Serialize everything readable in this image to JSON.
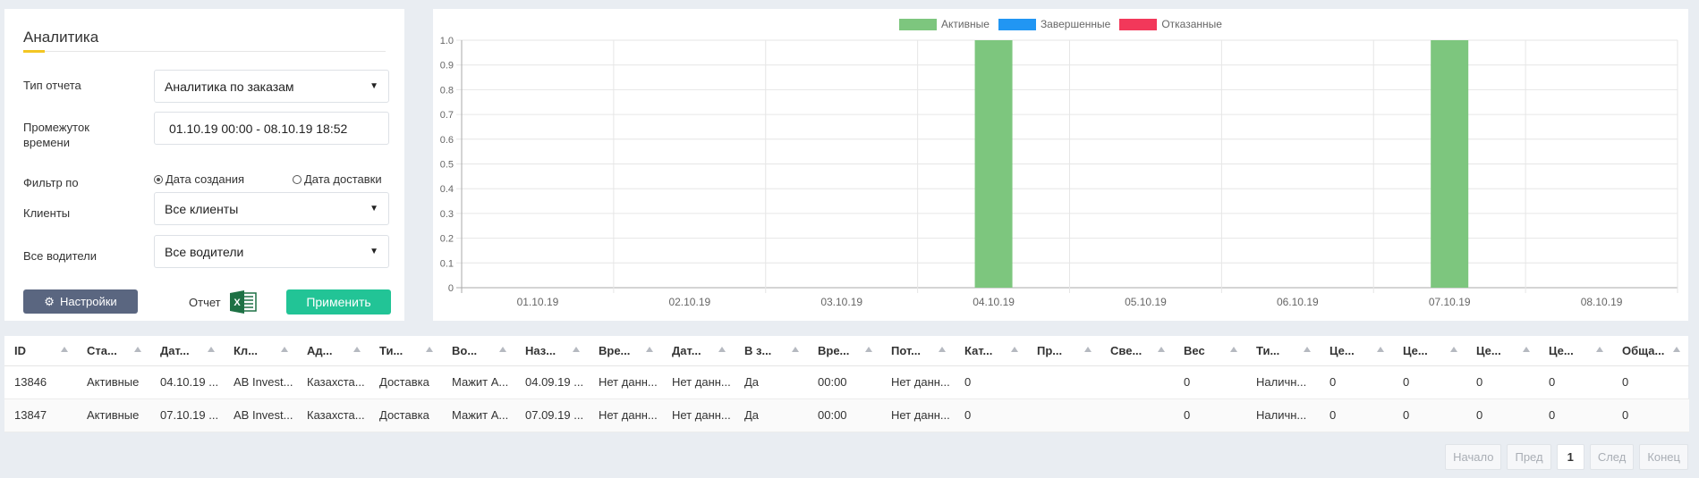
{
  "analytics": {
    "title": "Аналитика",
    "report_type_label": "Тип отчета",
    "report_type_value": "Аналитика по заказам",
    "time_range_label": "Промежуток времени",
    "time_range_value": "01.10.19 00:00 - 08.10.19 18:52",
    "filter_label": "Фильтр по",
    "filter_options": [
      "Дата создания",
      "Дата доставки"
    ],
    "filter_selected": "Дата создания",
    "clients_label": "Клиенты",
    "clients_value": "Все клиенты",
    "drivers_label": "Все водители",
    "drivers_value": "Все водители",
    "settings_button": "Настройки",
    "report_label": "Отчет",
    "apply_button": "Применить"
  },
  "colors": {
    "active": "#7dc67e",
    "completed": "#2196f3",
    "rejected": "#f2385a",
    "apply": "#22c496",
    "settings": "#5a6680"
  },
  "chart_data": {
    "type": "bar",
    "categories": [
      "01.10.19",
      "02.10.19",
      "03.10.19",
      "04.10.19",
      "05.10.19",
      "06.10.19",
      "07.10.19",
      "08.10.19"
    ],
    "series": [
      {
        "name": "Активные",
        "values": [
          0,
          0,
          0,
          1,
          0,
          0,
          1,
          0
        ],
        "color": "#7dc67e"
      },
      {
        "name": "Завершенные",
        "values": [
          0,
          0,
          0,
          0,
          0,
          0,
          0,
          0
        ],
        "color": "#2196f3"
      },
      {
        "name": "Отказанные",
        "values": [
          0,
          0,
          0,
          0,
          0,
          0,
          0,
          0
        ],
        "color": "#f2385a"
      }
    ],
    "y_ticks": [
      "0",
      "0.1",
      "0.2",
      "0.3",
      "0.4",
      "0.5",
      "0.6",
      "0.7",
      "0.8",
      "0.9",
      "1.0"
    ],
    "ylim": [
      0,
      1
    ],
    "grid": true,
    "legend": "top-center"
  },
  "table": {
    "columns": [
      "ID",
      "Ста...",
      "Дат...",
      "Кл...",
      "Ад...",
      "Ти...",
      "Во...",
      "Наз...",
      "Вре...",
      "Дат...",
      "В з...",
      "Вре...",
      "Пот...",
      "Кат...",
      "Пр...",
      "Све...",
      "Вес",
      "Ти...",
      "Це...",
      "Це...",
      "Це...",
      "Це...",
      "Обща..."
    ],
    "rows": [
      [
        "13846",
        "Активные",
        "04.10.19 ...",
        "AB Invest...",
        "Казахста...",
        "Доставка",
        "Мажит А...",
        "04.09.19 ...",
        "Нет данн...",
        "Нет данн...",
        "Да",
        "00:00",
        "Нет данн...",
        "0",
        "",
        "",
        "0",
        "Наличн...",
        "0",
        "0",
        "0",
        "0",
        "0"
      ],
      [
        "13847",
        "Активные",
        "07.10.19 ...",
        "AB Invest...",
        "Казахста...",
        "Доставка",
        "Мажит А...",
        "07.09.19 ...",
        "Нет данн...",
        "Нет данн...",
        "Да",
        "00:00",
        "Нет данн...",
        "0",
        "",
        "",
        "0",
        "Наличн...",
        "0",
        "0",
        "0",
        "0",
        "0"
      ]
    ]
  },
  "pagination": {
    "first": "Начало",
    "prev": "Пред",
    "current": "1",
    "next": "След",
    "last": "Конец"
  }
}
